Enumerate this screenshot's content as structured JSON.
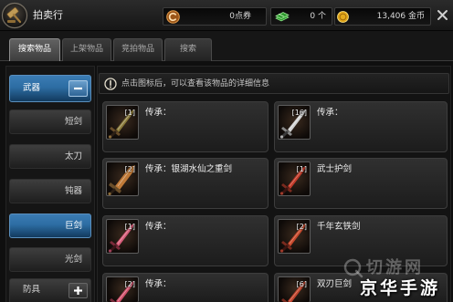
{
  "window": {
    "title": "拍卖行",
    "icon": "auction-house-emblem-icon"
  },
  "currencies": {
    "coupons": {
      "value": "0点券",
      "icon": "coupon-icon",
      "color": "#9c5618"
    },
    "gems": {
      "value": "0 个",
      "icon": "green-gem-icon",
      "color": "#2f9a2f"
    },
    "gold": {
      "value": "13,406 金币",
      "icon": "gold-coin-icon",
      "color": "#e3a91c"
    }
  },
  "tabs": [
    {
      "label": "搜索物品",
      "active": true
    },
    {
      "label": "上架物品",
      "active": false
    },
    {
      "label": "竞拍物品",
      "active": false
    },
    {
      "label": "搜索",
      "active": false
    }
  ],
  "sidebar": {
    "groups": [
      {
        "label": "武器",
        "expanded": true,
        "toggle_icon": "minus-icon",
        "items": [
          {
            "label": "短剑",
            "selected": false
          },
          {
            "label": "太刀",
            "selected": false
          },
          {
            "label": "钝器",
            "selected": false
          },
          {
            "label": "巨剑",
            "selected": true
          },
          {
            "label": "光剑",
            "selected": false
          }
        ]
      },
      {
        "label": "防具",
        "expanded": false,
        "toggle_icon": "plus-icon"
      }
    ]
  },
  "info_bar": {
    "icon": "info-icon",
    "text": "点击图标后，可以查看该物品的详细信息"
  },
  "items": [
    {
      "count": "[1]",
      "name": "传承：",
      "icon": "short-sword-icon",
      "color": "#8a7a3a"
    },
    {
      "count": "[16]",
      "name": "传承：",
      "icon": "silver-weapon-icon",
      "color": "#d0d0d0"
    },
    {
      "count": "[2]",
      "name": "传承：银湖水仙之重剑",
      "icon": "greatsword-icon",
      "color": "#c07a38"
    },
    {
      "count": "[1]",
      "name": "武士护剑",
      "icon": "red-sword-icon",
      "color": "#c23a2a"
    },
    {
      "count": "[1]",
      "name": "传承：",
      "icon": "pink-sword-icon",
      "color": "#d65c78"
    },
    {
      "count": "[2]",
      "name": "千年玄铁剑",
      "icon": "red-sword-icon",
      "color": "#c8482c"
    },
    {
      "count": "[2]",
      "name": "传承：",
      "icon": "pink-sword-icon",
      "color": "#d0506a"
    },
    {
      "count": "[6]",
      "name": "双刃巨剑",
      "icon": "red-sword-icon",
      "color": "#c0442e"
    }
  ],
  "theme": {
    "highlight": "#2d6da3"
  },
  "watermark": {
    "logo_text": "切游网",
    "text": "京华手游"
  }
}
